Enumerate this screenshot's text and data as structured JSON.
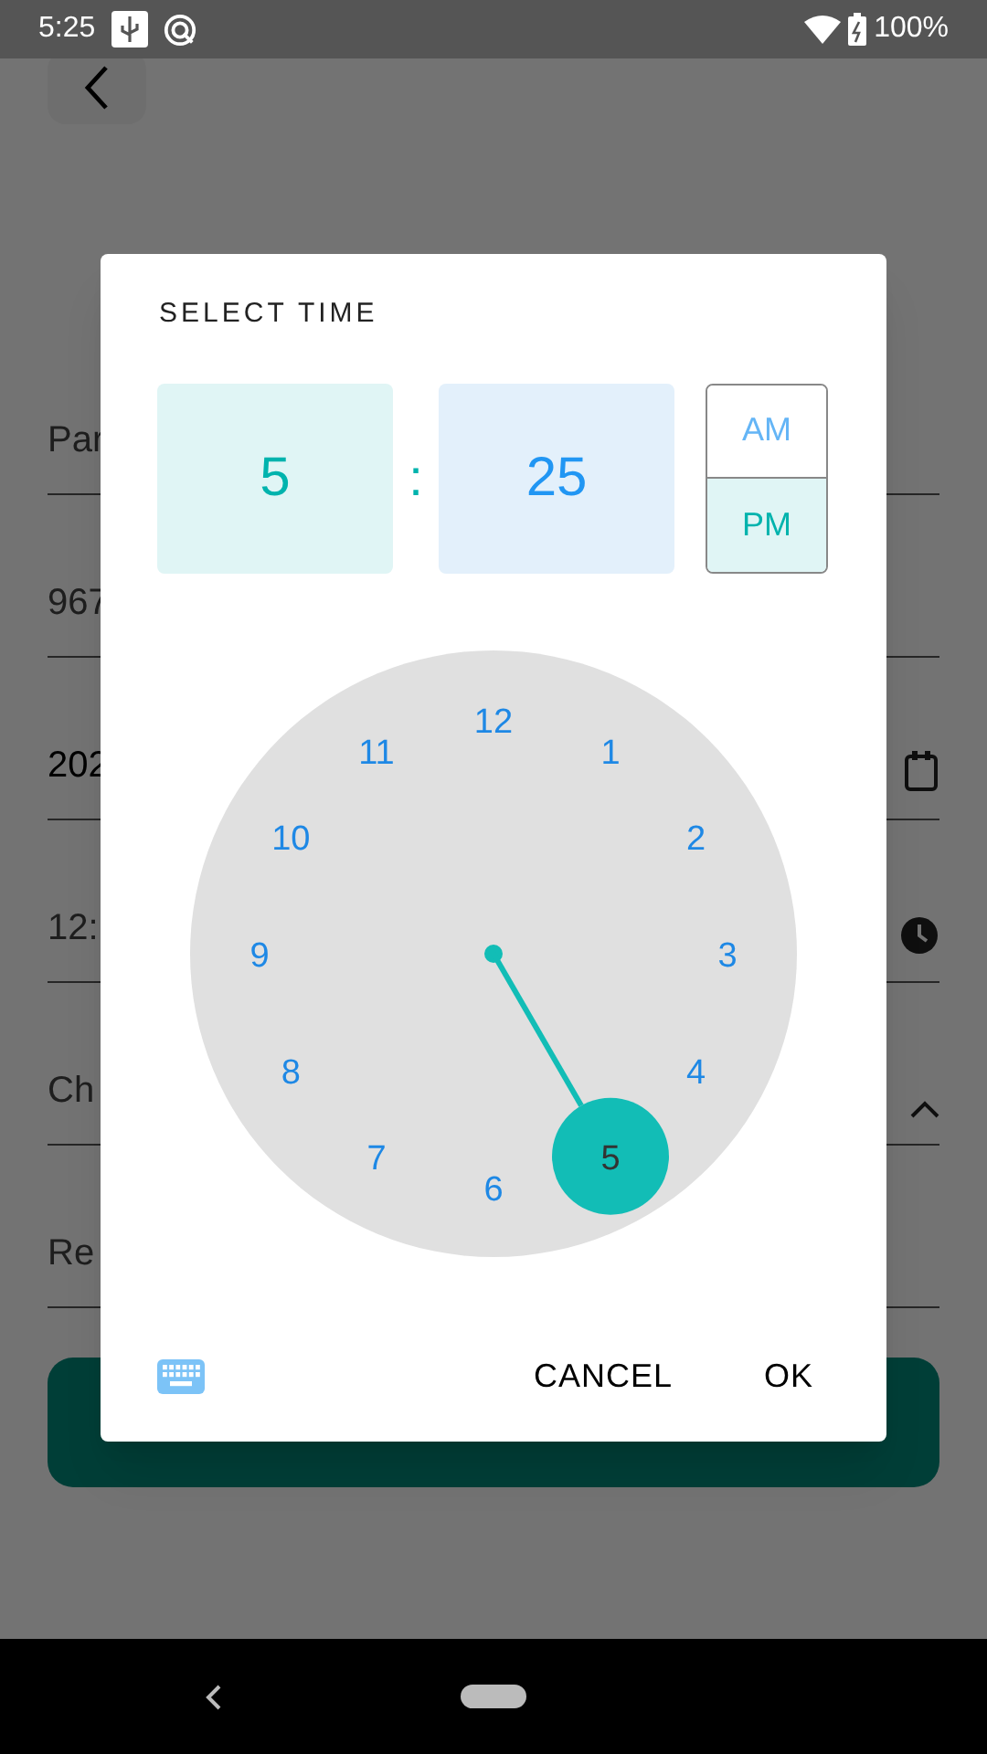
{
  "status_bar": {
    "time": "5:25",
    "battery": "100%"
  },
  "page": {
    "fields": [
      {
        "kind": "text",
        "value": "Par"
      },
      {
        "kind": "text",
        "value": "967"
      },
      {
        "kind": "date",
        "value": "202"
      },
      {
        "kind": "time",
        "value": "12:"
      },
      {
        "kind": "select",
        "value": "Ch"
      },
      {
        "kind": "text",
        "value": "Re"
      }
    ]
  },
  "dialog": {
    "header": "SELECT TIME",
    "hour": {
      "value": "5",
      "selected": true
    },
    "separator": ":",
    "minute": {
      "value": "25",
      "selected": false
    },
    "periods": [
      {
        "label": "AM",
        "selected": false
      },
      {
        "label": "PM",
        "selected": true
      }
    ],
    "clock": {
      "numbers": [
        {
          "label": "12",
          "selected": false
        },
        {
          "label": "1",
          "selected": false
        },
        {
          "label": "2",
          "selected": false
        },
        {
          "label": "3",
          "selected": false
        },
        {
          "label": "4",
          "selected": false
        },
        {
          "label": "5",
          "selected": true
        },
        {
          "label": "6",
          "selected": false
        },
        {
          "label": "7",
          "selected": false
        },
        {
          "label": "8",
          "selected": false
        },
        {
          "label": "9",
          "selected": false
        },
        {
          "label": "10",
          "selected": false
        },
        {
          "label": "11",
          "selected": false
        }
      ]
    },
    "buttons": [
      "CANCEL",
      "OK"
    ]
  }
}
